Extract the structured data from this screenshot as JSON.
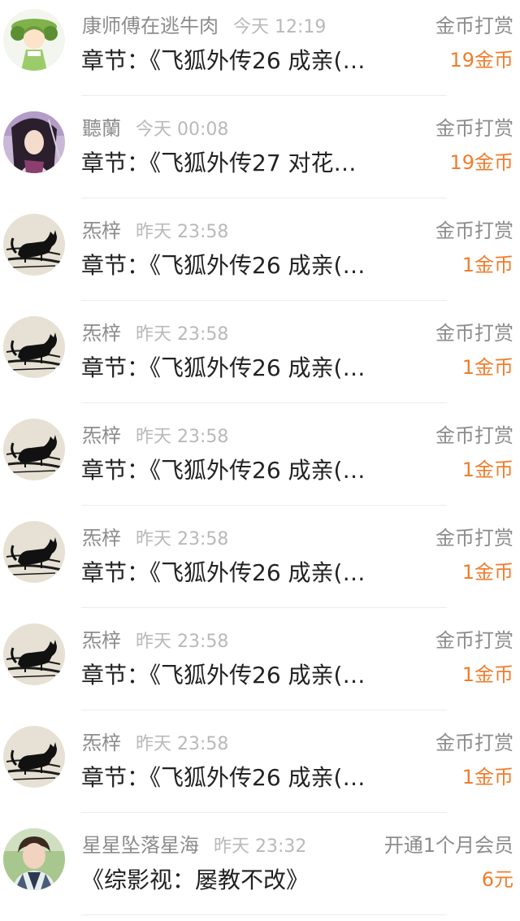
{
  "accent_color": "#f07d2c",
  "items": [
    {
      "user": "康师傅在逃牛肉",
      "time": "今天 12:19",
      "type": "金币打赏",
      "title": "章节：《飞狐外传26  成亲(…",
      "amount": "19金币",
      "avatar_icon": "anime-girl-green-avatar"
    },
    {
      "user": "聽蘭",
      "time": "今天 00:08",
      "type": "金币打赏",
      "title": "章节：《飞狐外传27  对花…",
      "amount": "19金币",
      "avatar_icon": "swordswoman-avatar"
    },
    {
      "user": "炁梓",
      "time": "昨天 23:58",
      "type": "金币打赏",
      "title": "章节：《飞狐外传26  成亲(…",
      "amount": "1金币",
      "avatar_icon": "black-cat-avatar"
    },
    {
      "user": "炁梓",
      "time": "昨天 23:58",
      "type": "金币打赏",
      "title": "章节：《飞狐外传26  成亲(…",
      "amount": "1金币",
      "avatar_icon": "black-cat-avatar"
    },
    {
      "user": "炁梓",
      "time": "昨天 23:58",
      "type": "金币打赏",
      "title": "章节：《飞狐外传26  成亲(…",
      "amount": "1金币",
      "avatar_icon": "black-cat-avatar"
    },
    {
      "user": "炁梓",
      "time": "昨天 23:58",
      "type": "金币打赏",
      "title": "章节：《飞狐外传26  成亲(…",
      "amount": "1金币",
      "avatar_icon": "black-cat-avatar"
    },
    {
      "user": "炁梓",
      "time": "昨天 23:58",
      "type": "金币打赏",
      "title": "章节：《飞狐外传26  成亲(…",
      "amount": "1金币",
      "avatar_icon": "black-cat-avatar"
    },
    {
      "user": "炁梓",
      "time": "昨天 23:58",
      "type": "金币打赏",
      "title": "章节：《飞狐外传26  成亲(…",
      "amount": "1金币",
      "avatar_icon": "black-cat-avatar"
    },
    {
      "user": "星星坠落星海",
      "time": "昨天 23:32",
      "type": "开通1个月会员",
      "title": "《综影视：屡教不改》",
      "amount": "6元",
      "avatar_icon": "boy-photo-avatar"
    }
  ]
}
